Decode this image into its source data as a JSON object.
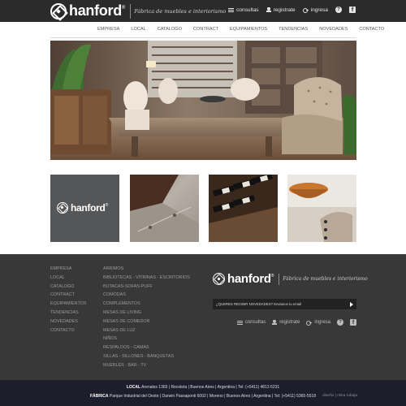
{
  "brand": {
    "name": "hanford",
    "reg": "®",
    "tagline": "Fábrica de muebles e interiorismo"
  },
  "top_links": {
    "consultas": "consultas",
    "registrate": "registrate",
    "ingresa": "ingresa",
    "help": "?",
    "facebook": "f"
  },
  "nav": [
    "EMPRESA",
    "LOCAL",
    "CATALOGO",
    "CONTRACT",
    "EQUIPAMIENTOS",
    "TENDENCIAS",
    "NOVEDADES",
    "CONTACTO"
  ],
  "thumb_logo": "hanford",
  "footer": {
    "col1": [
      "EMPRESA",
      "LOCAL",
      "CATALOGO",
      "CONTRACT",
      "EQUIPAMIENTOS",
      "TENDENCIAS",
      "NOVEDADES",
      "CONTACTO"
    ],
    "col2": [
      "ARRIMOS",
      "BIBLIOTECAS - VITRINAS - ESCRITORIOS",
      "BUTACAS-SOFAS-PUFF",
      "COMODAS",
      "COMPLEMENTOS",
      "MESAS DE LIVING",
      "MESAS DE COMEDOR",
      "MESAS DE LUZ",
      "NIÑOS",
      "RESPALDOS - CAMAS",
      "SILLAS - SILLONES - BANQUETAS",
      "MUEBLES - BAR - TV"
    ],
    "newsletter": "¿QUERES RECIBIR NOVEDADES? Envianos tu email",
    "links": {
      "consultas": "consultas",
      "registrate": "registrate",
      "ingresa": "ingresa",
      "help": "?",
      "facebook": "f"
    }
  },
  "address": {
    "local_label": "LOCAL",
    "local_text": "Arenales 1365 | Recoleta | Buenos Aires | Argentina | Tel: (+5411) 4813 6231",
    "fabrica_label": "FÁBRICA",
    "fabrica_text": "Parque Industrial del Oeste | Darwin Passaponti 6002 | Moreno | Buenos Aires | Argentina | Tel: (+5411) 5365-5518"
  },
  "credits": "diseño | mika rubaja",
  "colors": {
    "topbar": "#2b2b2b",
    "footer": "#383838",
    "bottombar": "#1d1d2b"
  }
}
